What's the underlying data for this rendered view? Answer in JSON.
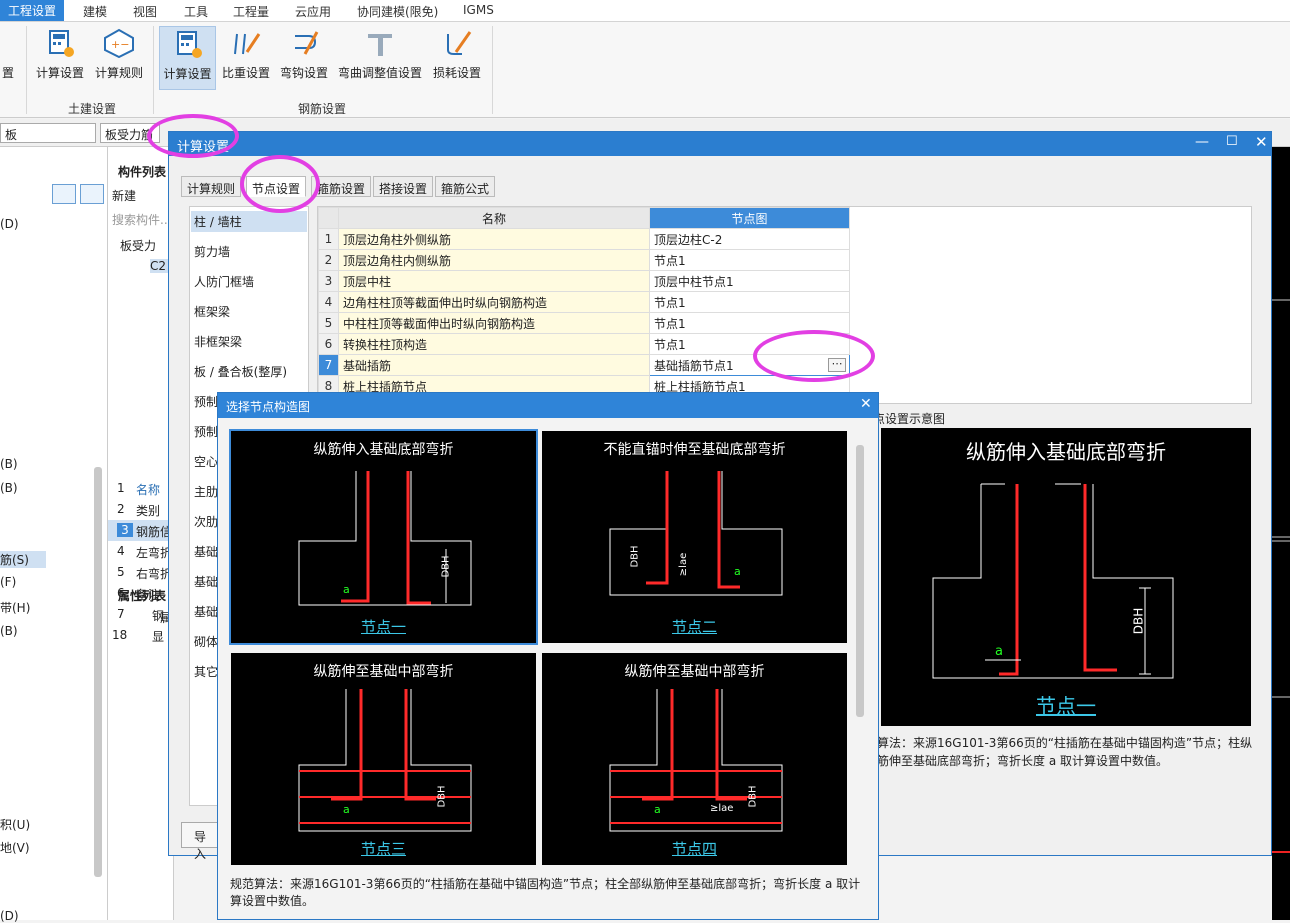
{
  "menu": {
    "items": [
      "工程设置",
      "建模",
      "视图",
      "工具",
      "工程量",
      "云应用",
      "协同建模(限免)",
      "IGMS"
    ]
  },
  "ribbon": {
    "tujian": {
      "label": "土建设置",
      "buttons": [
        "计算设置",
        "计算规则"
      ]
    },
    "gangjin": {
      "label": "钢筋设置",
      "buttons": [
        "计算设置",
        "比重设置",
        "弯钩设置",
        "弯曲调整值设置",
        "损耗设置"
      ]
    },
    "left_partial": "置"
  },
  "toolbar": {
    "combo1": "板",
    "combo2": "板受力筋",
    "checkbox_prefix": "◯"
  },
  "leftpanel": {
    "items": [
      "(D)",
      "(B)",
      "(B)",
      "筋(S)",
      "(F)",
      "带(H)",
      "(B)",
      "积(U)",
      "地(V)",
      "(D)"
    ]
  },
  "midpanel": {
    "header": "构件列表",
    "new_btn": "新建",
    "search_ph": "搜索构件...",
    "tree_root": "板受力",
    "tree_child": "C2",
    "props_header": "属性列表",
    "props_col": "属",
    "props": [
      {
        "n": "1",
        "v": "名称"
      },
      {
        "n": "2",
        "v": "类别"
      },
      {
        "n": "3",
        "v": "钢筋信"
      },
      {
        "n": "4",
        "v": "左弯折"
      },
      {
        "n": "5",
        "v": "右弯折"
      },
      {
        "n": "6",
        "v": "备注"
      },
      {
        "n": "7",
        "v": "钢"
      },
      {
        "n": "18",
        "v": "显"
      }
    ]
  },
  "dialog": {
    "title": "计算设置",
    "tabs": [
      "计算规则",
      "节点设置",
      "箍筋设置",
      "搭接设置",
      "箍筋公式"
    ],
    "categories": [
      "柱 / 墙柱",
      "剪力墙",
      "人防门框墙",
      "框架梁",
      "非框架梁",
      "板 / 叠合板(整厚)",
      "预制",
      "预制",
      "空心",
      "主肋",
      "次肋",
      "基础",
      "基础",
      "基础",
      "砌体",
      "其它"
    ],
    "grid_headers": {
      "name": "名称",
      "node": "节点图"
    },
    "rows": [
      {
        "n": "1",
        "name": "顶层边角柱外侧纵筋",
        "node": "顶层边柱C-2"
      },
      {
        "n": "2",
        "name": "顶层边角柱内侧纵筋",
        "node": "节点1"
      },
      {
        "n": "3",
        "name": "顶层中柱",
        "node": "顶层中柱节点1"
      },
      {
        "n": "4",
        "name": "边角柱柱顶等截面伸出时纵向钢筋构造",
        "node": "节点1"
      },
      {
        "n": "5",
        "name": "中柱柱顶等截面伸出时纵向钢筋构造",
        "node": "节点1"
      },
      {
        "n": "6",
        "name": "转换柱柱顶构造",
        "node": "节点1"
      },
      {
        "n": "7",
        "name": "基础插筋",
        "node": "基础插筋节点1"
      },
      {
        "n": "8",
        "name": "桩上柱插筋节点",
        "node": "桩上柱插筋节点1"
      }
    ],
    "ellipsis": "⋯",
    "import_btn": "导入",
    "preview": {
      "label": "点设置示意图",
      "title": "纵筋伸入基础底部弯折",
      "node_label": "节点一",
      "dbh": "DBH",
      "a": "a",
      "desc": "算法：来源16G101-3第66页的“柱插筋在基础中锚固构造”节点；柱纵筋伸至基础底部弯折；弯折长度 a 取计算设置中数值。"
    }
  },
  "popup": {
    "title": "选择节点构造图",
    "thumbs": [
      {
        "title": "纵筋伸入基础底部弯折",
        "label": "节点一"
      },
      {
        "title": "不能直锚时伸至基础底部弯折",
        "label": "节点二"
      },
      {
        "title": "纵筋伸至基础中部弯折",
        "label": "节点三"
      },
      {
        "title": "纵筋伸至基础中部弯折",
        "label": "节点四"
      }
    ],
    "desc": "规范算法：来源16G101-3第66页的“柱插筋在基础中锚固构造”节点；柱全部纵筋伸至基础底部弯折；弯折长度 a 取计算设置中数值。",
    "lae": "≥lae"
  },
  "colors": {
    "accent": "#2f84d8",
    "highlight": "#e23fe3",
    "rebar": "#ff2a2a"
  }
}
